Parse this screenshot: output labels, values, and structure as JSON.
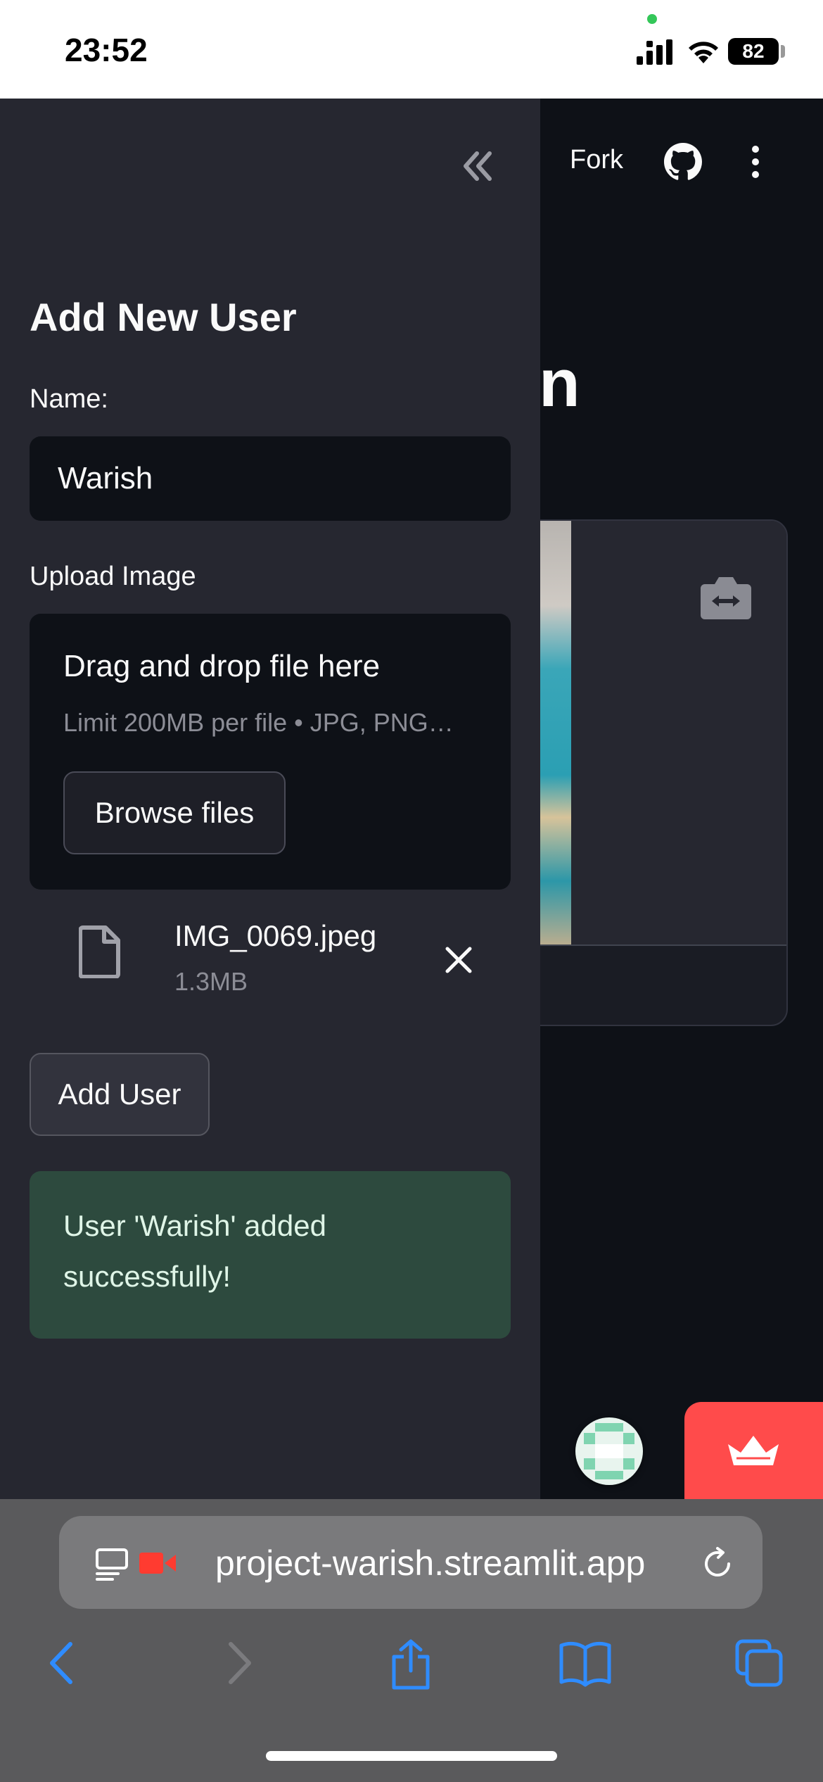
{
  "status_bar": {
    "time": "23:52",
    "battery": "82"
  },
  "app": {
    "toolbar": {
      "fork_label": "Fork"
    },
    "heading_fragment": "n"
  },
  "sidebar": {
    "title": "Add New User",
    "name_label": "Name:",
    "name_value": "Warish",
    "upload_label": "Upload Image",
    "dropzone_title": "Drag and drop file here",
    "dropzone_hint": "Limit 200MB per file • JPG, PNG…",
    "browse_label": "Browse files",
    "file": {
      "name": "IMG_0069.jpeg",
      "size": "1.3MB"
    },
    "add_user_label": "Add User",
    "success_message": "User 'Warish' added successfully!"
  },
  "browser": {
    "url": "project-warish.streamlit.app"
  },
  "colors": {
    "sidebar_bg": "#262730",
    "main_bg": "#0e1117",
    "success_bg": "#2d4a3e",
    "streamlit_red": "#ff4b4b",
    "link_blue": "#2f8cff"
  }
}
